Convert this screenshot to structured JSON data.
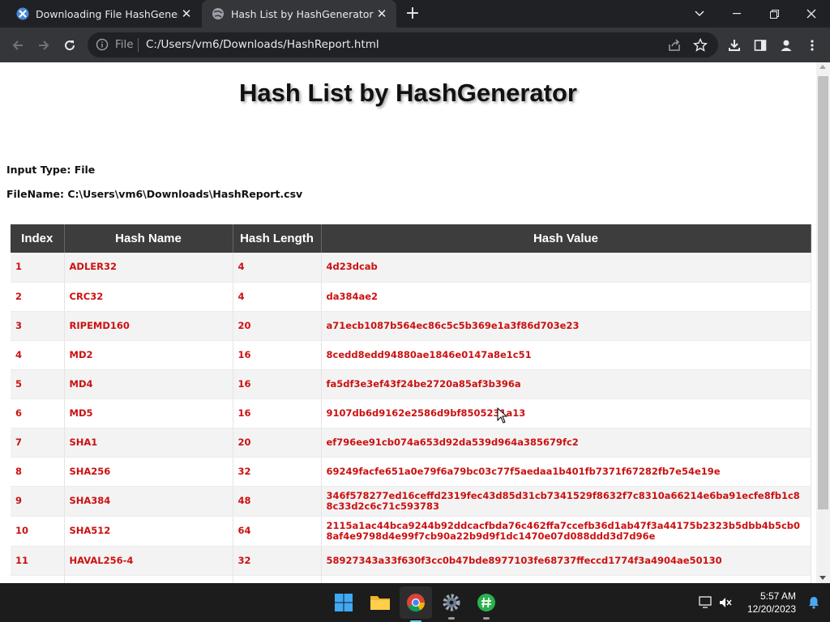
{
  "browser": {
    "tabs": [
      {
        "title": "Downloading File HashGenerator",
        "active": false
      },
      {
        "title": "Hash List by HashGenerator",
        "active": true
      }
    ],
    "new_tab": "+",
    "omnibox": {
      "scheme": "File",
      "url": "C:/Users/vm6/Downloads/HashReport.html"
    }
  },
  "page": {
    "title": "Hash List by HashGenerator",
    "input_type": "Input Type: File",
    "file_name": "FileName: C:\\Users\\vm6\\Downloads\\HashReport.csv",
    "table": {
      "headers": [
        "Index",
        "Hash Name",
        "Hash Length",
        "Hash Value"
      ],
      "rows": [
        {
          "index": "1",
          "name": "ADLER32",
          "length": "4",
          "value": "4d23dcab"
        },
        {
          "index": "2",
          "name": "CRC32",
          "length": "4",
          "value": "da384ae2"
        },
        {
          "index": "3",
          "name": "RIPEMD160",
          "length": "20",
          "value": "a71ecb1087b564ec86c5c5b369e1a3f86d703e23"
        },
        {
          "index": "4",
          "name": "MD2",
          "length": "16",
          "value": "8cedd8edd94880ae1846e0147a8e1c51"
        },
        {
          "index": "5",
          "name": "MD4",
          "length": "16",
          "value": "fa5df3e3ef43f24be2720a85af3b396a"
        },
        {
          "index": "6",
          "name": "MD5",
          "length": "16",
          "value": "9107db6d9162e2586d9bf8505231a13"
        },
        {
          "index": "7",
          "name": "SHA1",
          "length": "20",
          "value": "ef796ee91cb074a653d92da539d964a385679fc2"
        },
        {
          "index": "8",
          "name": "SHA256",
          "length": "32",
          "value": "69249facfe651a0e79f6a79bc03c77f5aedaa1b401fb7371f67282fb7e54e19e"
        },
        {
          "index": "9",
          "name": "SHA384",
          "length": "48",
          "value": "346f578277ed16ceffd2319fec43d85d31cb7341529f8632f7c8310a66214e6ba91ecfe8fb1c88c33d2c6c71c593783"
        },
        {
          "index": "10",
          "name": "SHA512",
          "length": "64",
          "value": "2115a1ac44bca9244b92ddcacfbda76c462ffa7ccefb36d1ab47f3a44175b2323b5dbb4b5cb08af4e9798d4e99f7cb90a22b9d9f1dc1470e07d088ddd3d7d96e"
        },
        {
          "index": "11",
          "name": "HAVAL256-4",
          "length": "32",
          "value": "58927343a33f630f3cc0b47bde8977103fe68737ffeccd1774f3a4904ae50130"
        }
      ]
    }
  },
  "taskbar": {
    "time": "5:57 AM",
    "date": "12/20/2023"
  },
  "colors": {
    "table_header_bg": "#3d3d3d",
    "cell_text": "#cc1111",
    "browser_frame": "#202124",
    "toolbar": "#35363a"
  }
}
